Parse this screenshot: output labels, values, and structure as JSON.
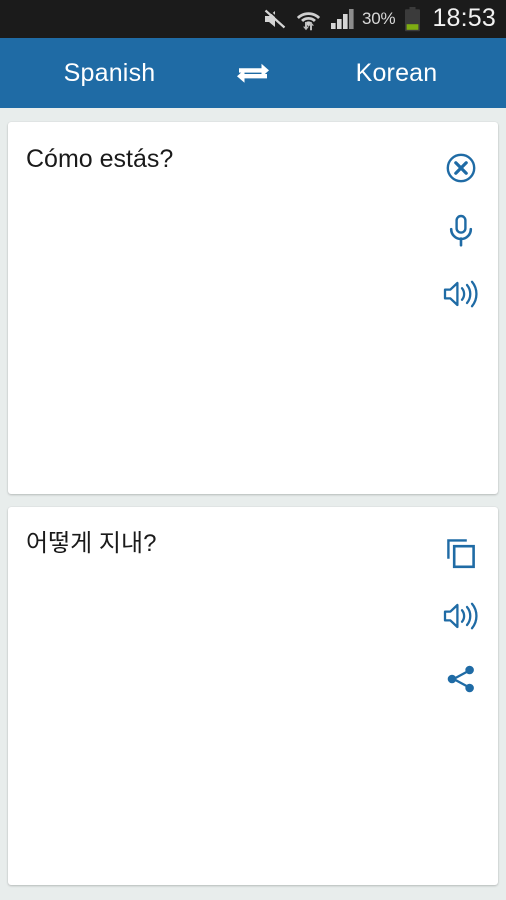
{
  "status_bar": {
    "battery_percent": "30%",
    "clock": "18:53",
    "icons": [
      {
        "name": "volume-mute-icon",
        "label": "Silent mode"
      },
      {
        "name": "wifi-icon",
        "label": "Wi-Fi connected with data transfer"
      },
      {
        "name": "cellular-signal-icon",
        "label": "Cellular signal"
      },
      {
        "name": "battery-icon",
        "label": "Battery 30%"
      }
    ]
  },
  "header": {
    "source_language": "Spanish",
    "target_language": "Korean",
    "swap_icon": "swap-horizontal-icon",
    "background_color": "#1f6ba5",
    "text_color": "#ffffff"
  },
  "source_card": {
    "text": "Cómo estás?",
    "actions": [
      {
        "name": "clear-button",
        "icon": "clear-circle-icon",
        "label": "Clear"
      },
      {
        "name": "voice-input-button",
        "icon": "microphone-icon",
        "label": "Speak"
      },
      {
        "name": "listen-source-button",
        "icon": "speaker-icon",
        "label": "Listen"
      }
    ]
  },
  "target_card": {
    "text": "어떻게 지내?",
    "actions": [
      {
        "name": "copy-button",
        "icon": "copy-icon",
        "label": "Copy"
      },
      {
        "name": "listen-target-button",
        "icon": "speaker-icon",
        "label": "Listen"
      },
      {
        "name": "share-button",
        "icon": "share-icon",
        "label": "Share"
      }
    ]
  },
  "theme": {
    "accent_color": "#1f6ba5",
    "page_background": "#e8edec",
    "card_background": "#ffffff",
    "text_color": "#1a1a1a",
    "status_bar_background": "#1b1b1b",
    "battery_fill_color": "#7fad12"
  }
}
